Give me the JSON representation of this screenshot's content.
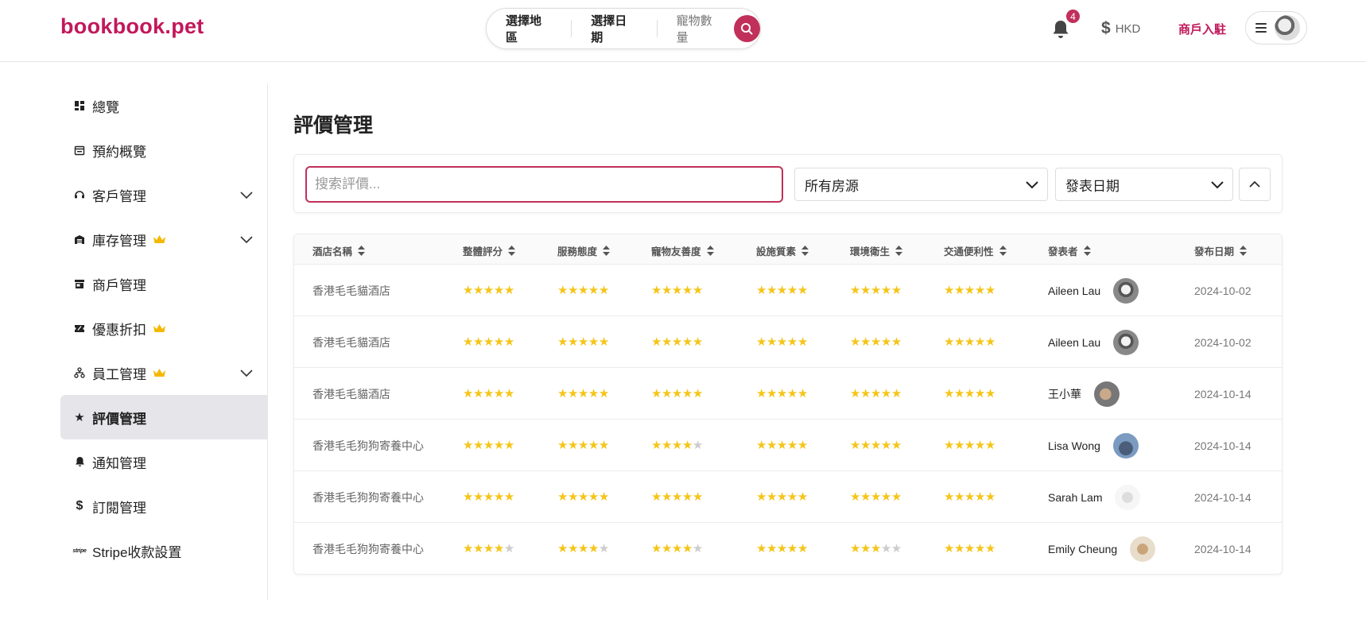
{
  "brand": {
    "logo": "bookbook.pet",
    "accent": "#c2185b"
  },
  "search_bar": {
    "region": "選擇地區",
    "date": "選擇日期",
    "pets": "寵物數量"
  },
  "header": {
    "notification_count": "4",
    "currency": "HKD",
    "merchant_link": "商戶入駐"
  },
  "sidebar": {
    "items": [
      {
        "label": "總覽",
        "icon": "dashboard-icon"
      },
      {
        "label": "預約概覽",
        "icon": "calendar-icon"
      },
      {
        "label": "客戶管理",
        "icon": "headset-icon",
        "expandable": true
      },
      {
        "label": "庫存管理",
        "icon": "warehouse-icon",
        "premium": true,
        "expandable": true
      },
      {
        "label": "商戶管理",
        "icon": "store-icon"
      },
      {
        "label": "優惠折扣",
        "icon": "coupon-icon",
        "premium": true
      },
      {
        "label": "員工管理",
        "icon": "staff-icon",
        "premium": true,
        "expandable": true
      },
      {
        "label": "評價管理",
        "icon": "star-icon",
        "active": true
      },
      {
        "label": "通知管理",
        "icon": "bell-icon"
      },
      {
        "label": "訂閱管理",
        "icon": "dollar-icon"
      },
      {
        "label": "Stripe收款設置",
        "icon": "stripe-icon"
      }
    ]
  },
  "main": {
    "title": "評價管理",
    "filters": {
      "search_placeholder": "搜索評價...",
      "property_select": "所有房源",
      "date_select": "發表日期"
    },
    "table": {
      "columns": [
        "酒店名稱",
        "整體評分",
        "服務態度",
        "寵物友善度",
        "設施質素",
        "環境衛生",
        "交通便利性",
        "發表者",
        "發布日期"
      ],
      "rows": [
        {
          "hotel": "香港毛毛貓酒店",
          "ratings": [
            5,
            5,
            5,
            5,
            5,
            5
          ],
          "author": "Aileen Lau",
          "date": "2024-10-02"
        },
        {
          "hotel": "香港毛毛貓酒店",
          "ratings": [
            5,
            5,
            5,
            5,
            5,
            5
          ],
          "author": "Aileen Lau",
          "date": "2024-10-02"
        },
        {
          "hotel": "香港毛毛貓酒店",
          "ratings": [
            5,
            5,
            5,
            5,
            5,
            5
          ],
          "author": "王小華",
          "date": "2024-10-14"
        },
        {
          "hotel": "香港毛毛狗狗寄養中心",
          "ratings": [
            5,
            5,
            4,
            5,
            5,
            5
          ],
          "author": "Lisa Wong",
          "date": "2024-10-14"
        },
        {
          "hotel": "香港毛毛狗狗寄養中心",
          "ratings": [
            5,
            5,
            5,
            5,
            5,
            5
          ],
          "author": "Sarah Lam",
          "date": "2024-10-14"
        },
        {
          "hotel": "香港毛毛狗狗寄養中心",
          "ratings": [
            4,
            4,
            4,
            5,
            3,
            5
          ],
          "author": "Emily Cheung",
          "date": "2024-10-14"
        }
      ]
    }
  },
  "colors": {
    "star": "#f5c518",
    "star_off": "#cccccc",
    "active_bg": "#e6e6ea"
  }
}
